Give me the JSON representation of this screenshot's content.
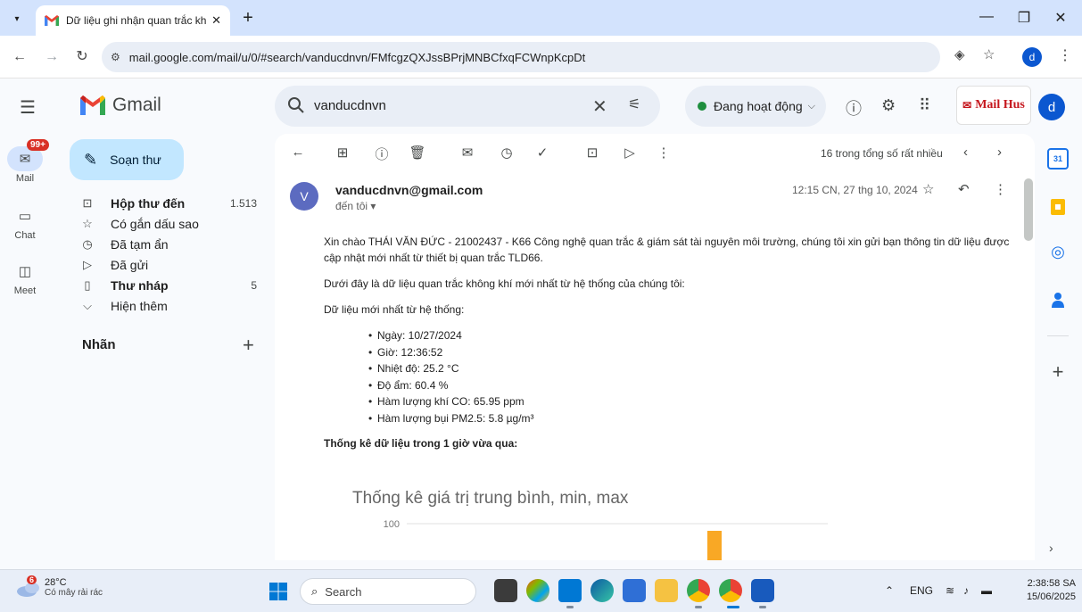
{
  "browser": {
    "tab_title": "Dữ liệu ghi nhận quan trắc khô",
    "url": "mail.google.com/mail/u/0/#search/vanducdnvn/FMfcgzQXJssBPrjMNBCfxqFCWnpKcpDt",
    "profile_initial": "d"
  },
  "gmail": {
    "brand": "Gmail",
    "search_query": "vanducdnvn",
    "status_label": "Đang hoạt động",
    "brand_badge": "Mail Hus",
    "avatar_initial": "d"
  },
  "rail": {
    "mail_label": "Mail",
    "mail_badge": "99+",
    "chat_label": "Chat",
    "meet_label": "Meet"
  },
  "sidebar": {
    "compose_label": "Soạn thư",
    "items": [
      {
        "label": "Hộp thư đến",
        "count": "1.513",
        "icon": "inbox-icon"
      },
      {
        "label": "Có gắn dấu sao",
        "count": "",
        "icon": "star-icon"
      },
      {
        "label": "Đã tạm ẩn",
        "count": "",
        "icon": "clock-icon"
      },
      {
        "label": "Đã gửi",
        "count": "",
        "icon": "send-icon"
      },
      {
        "label": "Thư nháp",
        "count": "5",
        "icon": "draft-icon"
      },
      {
        "label": "Hiện thêm",
        "count": "",
        "icon": "chevron-down-icon"
      }
    ],
    "labels_heading": "Nhãn"
  },
  "toolbar": {
    "count_text": "16 trong tổng số rất nhiều"
  },
  "message": {
    "avatar_initial": "V",
    "sender": "vanducdnvn@gmail.com",
    "recipient": "đến tôi ▾",
    "date": "12:15 CN, 27 thg 10, 2024",
    "greeting": "Xin chào THÁI VĂN ĐỨC - 21002437 - K66 Công nghệ quan trắc & giám sát tài nguyên môi trường, chúng tôi xin gửi bạn thông tin dữ liệu được cập nhật mới nhất từ thiết bị quan trắc TLD66.",
    "intro": "Dưới đây là dữ liệu quan trắc không khí mới nhất từ hệ thống của chúng tôi:",
    "latest_heading": "Dữ liệu mới nhất từ hệ thống:",
    "readings": [
      "Ngày: 10/27/2024",
      "Giờ: 12:36:52",
      "Nhiệt độ: 25.2 °C",
      "Độ ẩm: 60.4 %",
      "Hàm lượng khí CO: 65.95 ppm",
      "Hàm lượng bụi PM2.5: 5.8 µg/m³"
    ],
    "stats_heading": "Thống kê dữ liệu trong 1 giờ vừa qua:"
  },
  "chart_data": {
    "type": "bar",
    "title": "Thống kê giá trị trung bình, min, max",
    "y_tick_visible": "100",
    "visible_bar": {
      "value": 100,
      "color": "#f9a825"
    },
    "colors": {
      "bar": "#f9a825",
      "grid": "#e0e0e0"
    }
  },
  "taskbar": {
    "weather_temp": "28°C",
    "weather_desc": "Có mây rải rác",
    "weather_badge": "6",
    "search_placeholder": "Search",
    "lang": "ENG",
    "time": "2:38:58 SA",
    "date": "15/06/2025"
  }
}
